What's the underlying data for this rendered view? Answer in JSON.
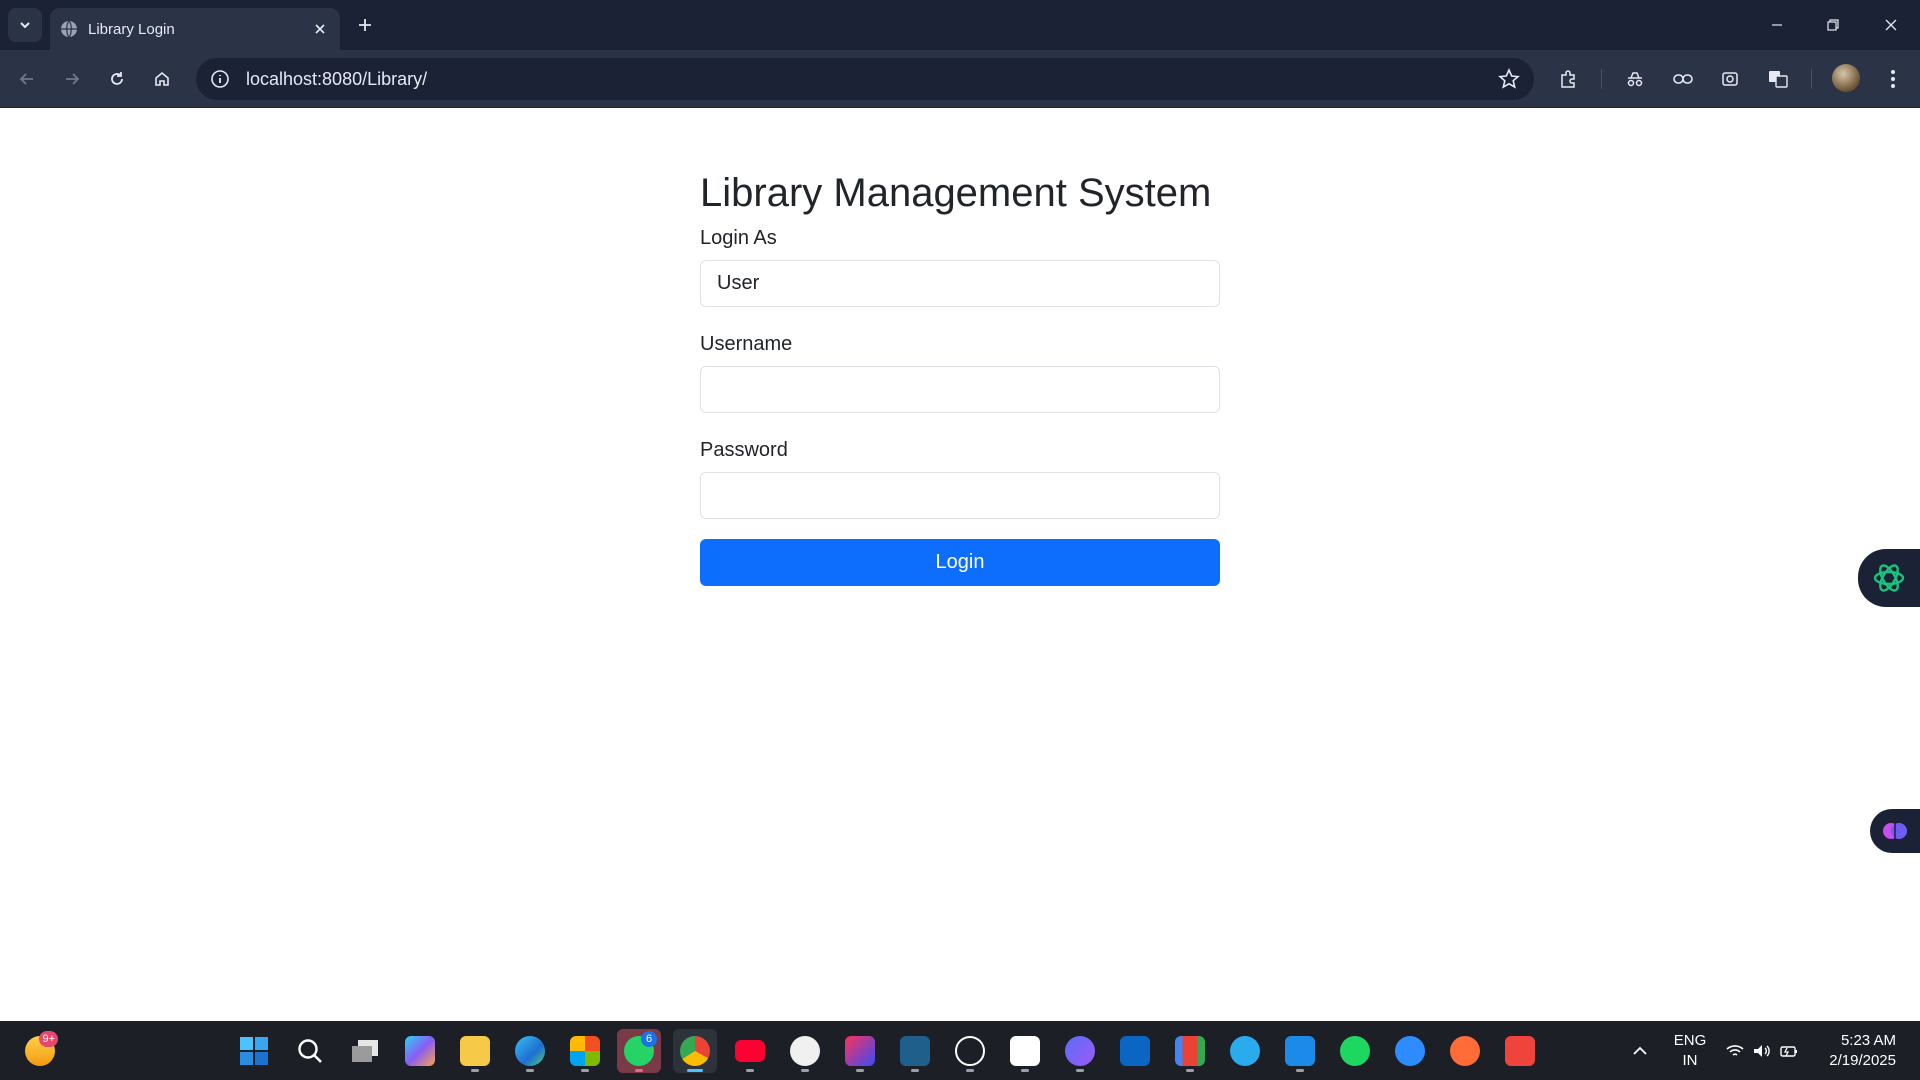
{
  "browser": {
    "tab_title": "Library Login",
    "url": "localhost:8080/Library/"
  },
  "page": {
    "heading": "Library Management System",
    "login_as": {
      "label": "Login As",
      "value": "User"
    },
    "username": {
      "label": "Username",
      "value": ""
    },
    "password": {
      "label": "Password",
      "value": ""
    },
    "login_button": "Login",
    "accent_color": "#0d6efd"
  },
  "taskbar": {
    "start_badge": "9+",
    "whatsapp_badge": "6",
    "language": "ENG",
    "region": "IN",
    "time": "5:23 AM",
    "date": "2/19/2025",
    "apps": [
      "widgets-icon",
      "start-icon",
      "search-icon",
      "task-view-icon",
      "copilot-icon",
      "file-explorer-icon",
      "edge-icon",
      "store-icon",
      "whatsapp-icon",
      "chrome-icon",
      "youtube-icon",
      "github-icon",
      "intellij-icon",
      "mysql-workbench-icon",
      "chatgpt-icon",
      "chatgpt-app-icon",
      "arc-icon",
      "linkedin-icon",
      "gmail-icon",
      "telegram-icon",
      "vscode-icon",
      "spotify-icon",
      "zoom-icon",
      "postman-icon",
      "anydesk-icon"
    ]
  }
}
